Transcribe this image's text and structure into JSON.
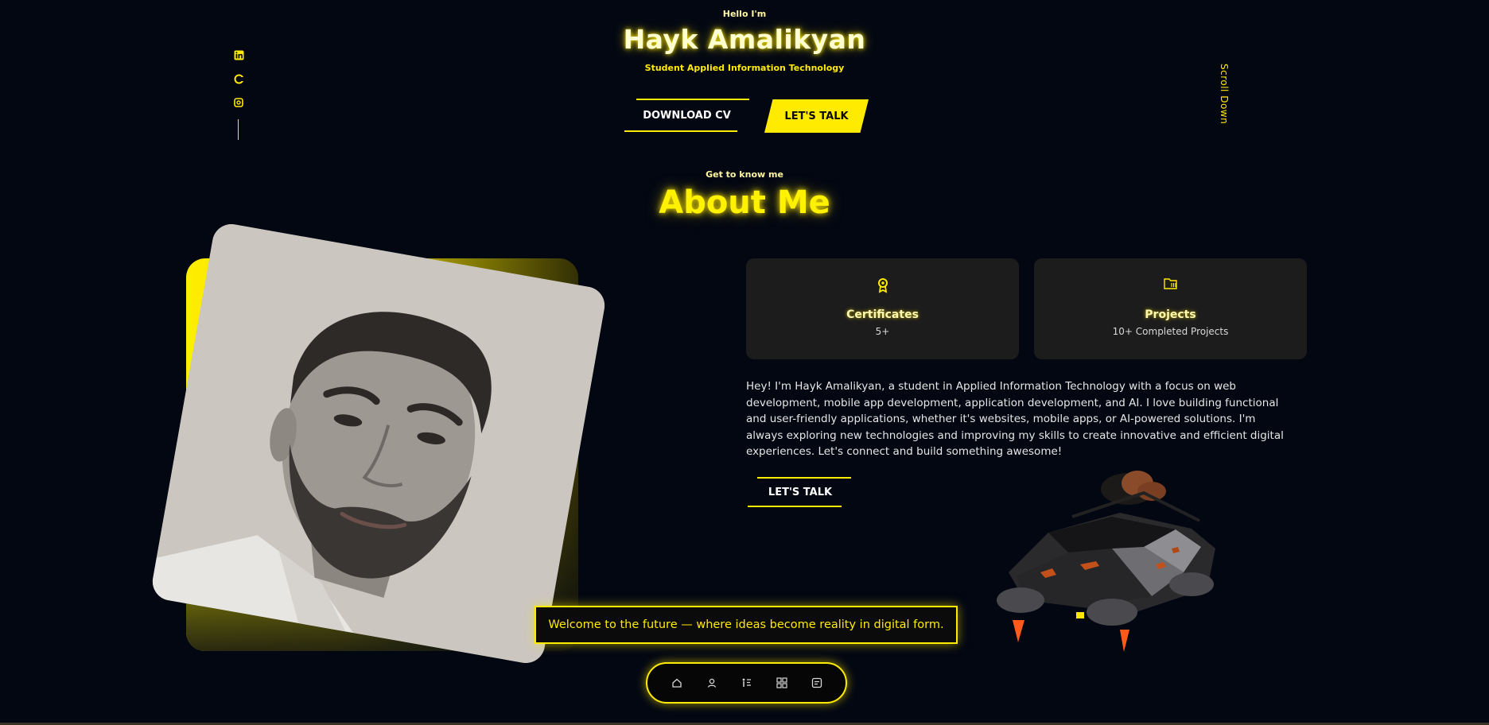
{
  "hero": {
    "greeting": "Hello I'm",
    "name": "Hayk Amalikyan",
    "tagline": "Student Applied Information Technology",
    "download_cv_label": "DOWNLOAD CV",
    "lets_talk_label": "LET'S TALK",
    "scroll_down_label": "Scroll Down"
  },
  "socials": [
    "linkedin-icon",
    "github-icon",
    "instagram-icon"
  ],
  "about": {
    "kicker": "Get to know me",
    "title": "About Me",
    "cards": [
      {
        "icon": "award-icon",
        "title": "Certificates",
        "value": "5+"
      },
      {
        "icon": "folder-icon",
        "title": "Projects",
        "value": "10+ Completed Projects"
      }
    ],
    "bio": "Hey! I'm Hayk Amalikyan, a student in Applied Information Technology with a focus on web development, mobile app development, application development, and AI. I love building functional and user-friendly applications, whether it's websites, mobile apps, or AI-powered solutions. I'm always exploring new technologies and improving my skills to create innovative and efficient digital experiences. Let's connect and build something awesome!",
    "lets_talk_label": "LET'S TALK"
  },
  "banner": "Welcome to the future — where ideas become reality in digital form.",
  "dock": [
    "home-icon",
    "user-icon",
    "experience-icon",
    "grid-icon",
    "message-icon"
  ],
  "colors": {
    "accent": "#ffeb00",
    "background": "#030712",
    "card": "#1c1c1c"
  }
}
